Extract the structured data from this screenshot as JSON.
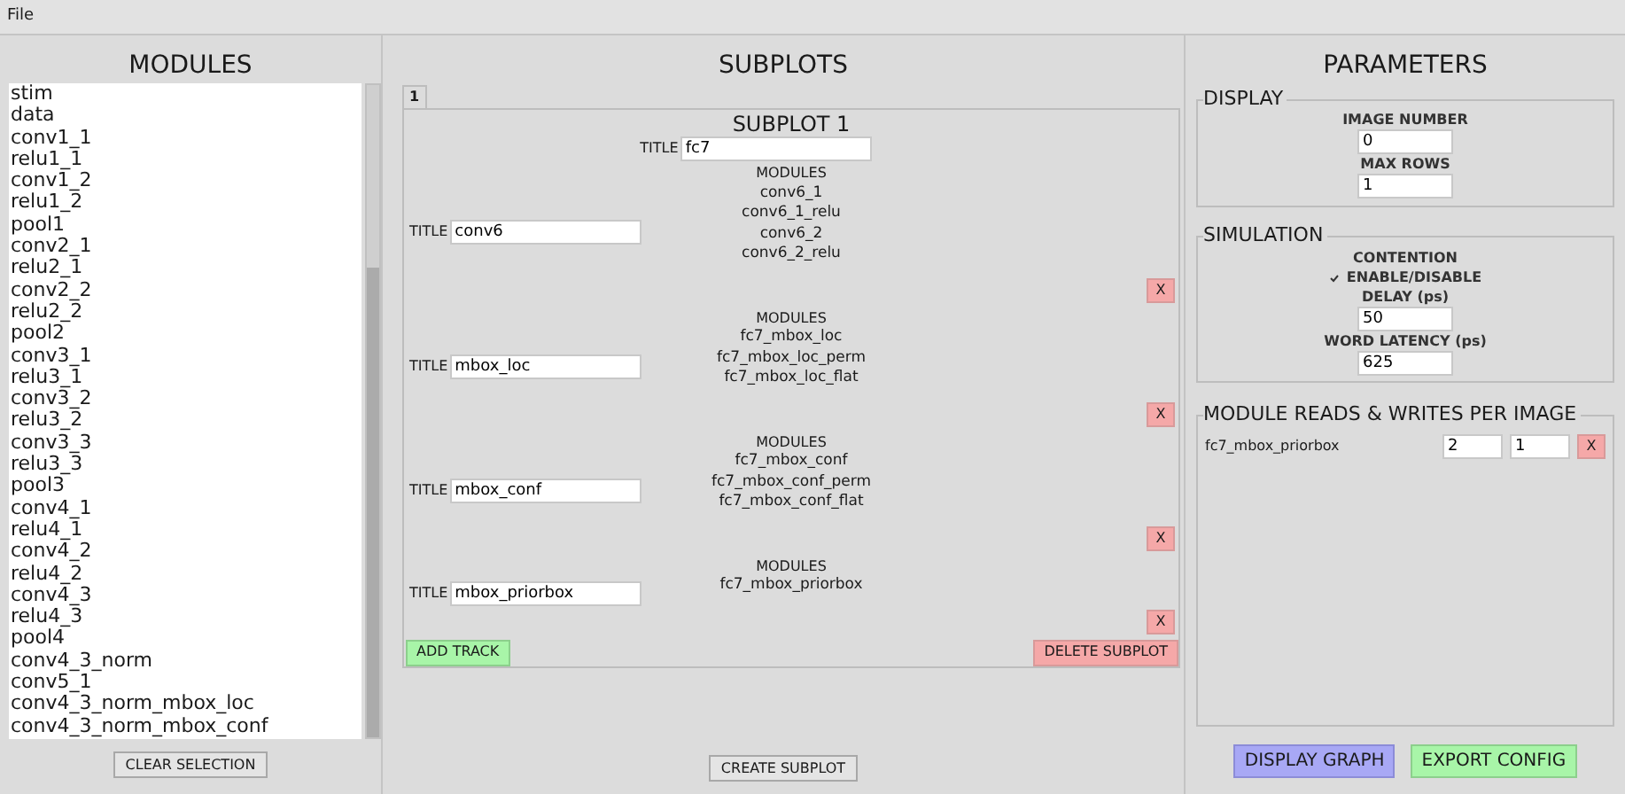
{
  "menu": [
    "File"
  ],
  "modules_panel": {
    "title": "MODULES",
    "items": [
      "stim",
      "data",
      "conv1_1",
      "relu1_1",
      "conv1_2",
      "relu1_2",
      "pool1",
      "conv2_1",
      "relu2_1",
      "conv2_2",
      "relu2_2",
      "pool2",
      "conv3_1",
      "relu3_1",
      "conv3_2",
      "relu3_2",
      "conv3_3",
      "relu3_3",
      "pool3",
      "conv4_1",
      "relu4_1",
      "conv4_2",
      "relu4_2",
      "conv4_3",
      "relu4_3",
      "pool4",
      "conv4_3_norm",
      "conv5_1",
      "conv4_3_norm_mbox_loc",
      "conv4_3_norm_mbox_conf"
    ],
    "clear_button": "CLEAR SELECTION"
  },
  "subplots_panel": {
    "title": "SUBPLOTS",
    "tabs": [
      {
        "label": "1",
        "selected": true
      }
    ],
    "subplot": {
      "heading": "SUBPLOT 1",
      "title_label": "TITLE",
      "title_value": "fc7",
      "tracks": [
        {
          "title_label": "TITLE",
          "title_value": "conv6",
          "modules_label": "MODULES",
          "modules": [
            "conv6_1",
            "conv6_1_relu",
            "conv6_2",
            "conv6_2_relu"
          ],
          "remove": "X"
        },
        {
          "title_label": "TITLE",
          "title_value": "mbox_loc",
          "modules_label": "MODULES",
          "modules": [
            "fc7_mbox_loc",
            "fc7_mbox_loc_perm",
            "fc7_mbox_loc_flat"
          ],
          "remove": "X"
        },
        {
          "title_label": "TITLE",
          "title_value": "mbox_conf",
          "modules_label": "MODULES",
          "modules": [
            "fc7_mbox_conf",
            "fc7_mbox_conf_perm",
            "fc7_mbox_conf_flat"
          ],
          "remove": "X"
        },
        {
          "title_label": "TITLE",
          "title_value": "mbox_priorbox",
          "modules_label": "MODULES",
          "modules": [
            "fc7_mbox_priorbox"
          ],
          "remove": "X"
        }
      ],
      "add_track": "ADD TRACK",
      "delete_subplot": "DELETE SUBPLOT"
    },
    "create_button": "CREATE SUBPLOT"
  },
  "parameters_panel": {
    "title": "PARAMETERS",
    "display": {
      "legend": "DISPLAY",
      "image_number_label": "IMAGE NUMBER",
      "image_number": "0",
      "max_rows_label": "MAX ROWS",
      "max_rows": "1"
    },
    "simulation": {
      "legend": "SIMULATION",
      "contention_label": "CONTENTION",
      "enable": {
        "label": "ENABLE/DISABLE",
        "checked": true
      },
      "delay_label": "DELAY (ps)",
      "delay": "50",
      "latency_label": "WORD LATENCY (ps)",
      "latency": "625"
    },
    "reads_writes": {
      "legend": "MODULE READS & WRITES PER IMAGE",
      "rows": [
        {
          "module": "fc7_mbox_priorbox",
          "reads": "2",
          "writes": "1",
          "remove": "X"
        }
      ]
    },
    "display_graph": "DISPLAY GRAPH",
    "export_config": "EXPORT CONFIG"
  }
}
